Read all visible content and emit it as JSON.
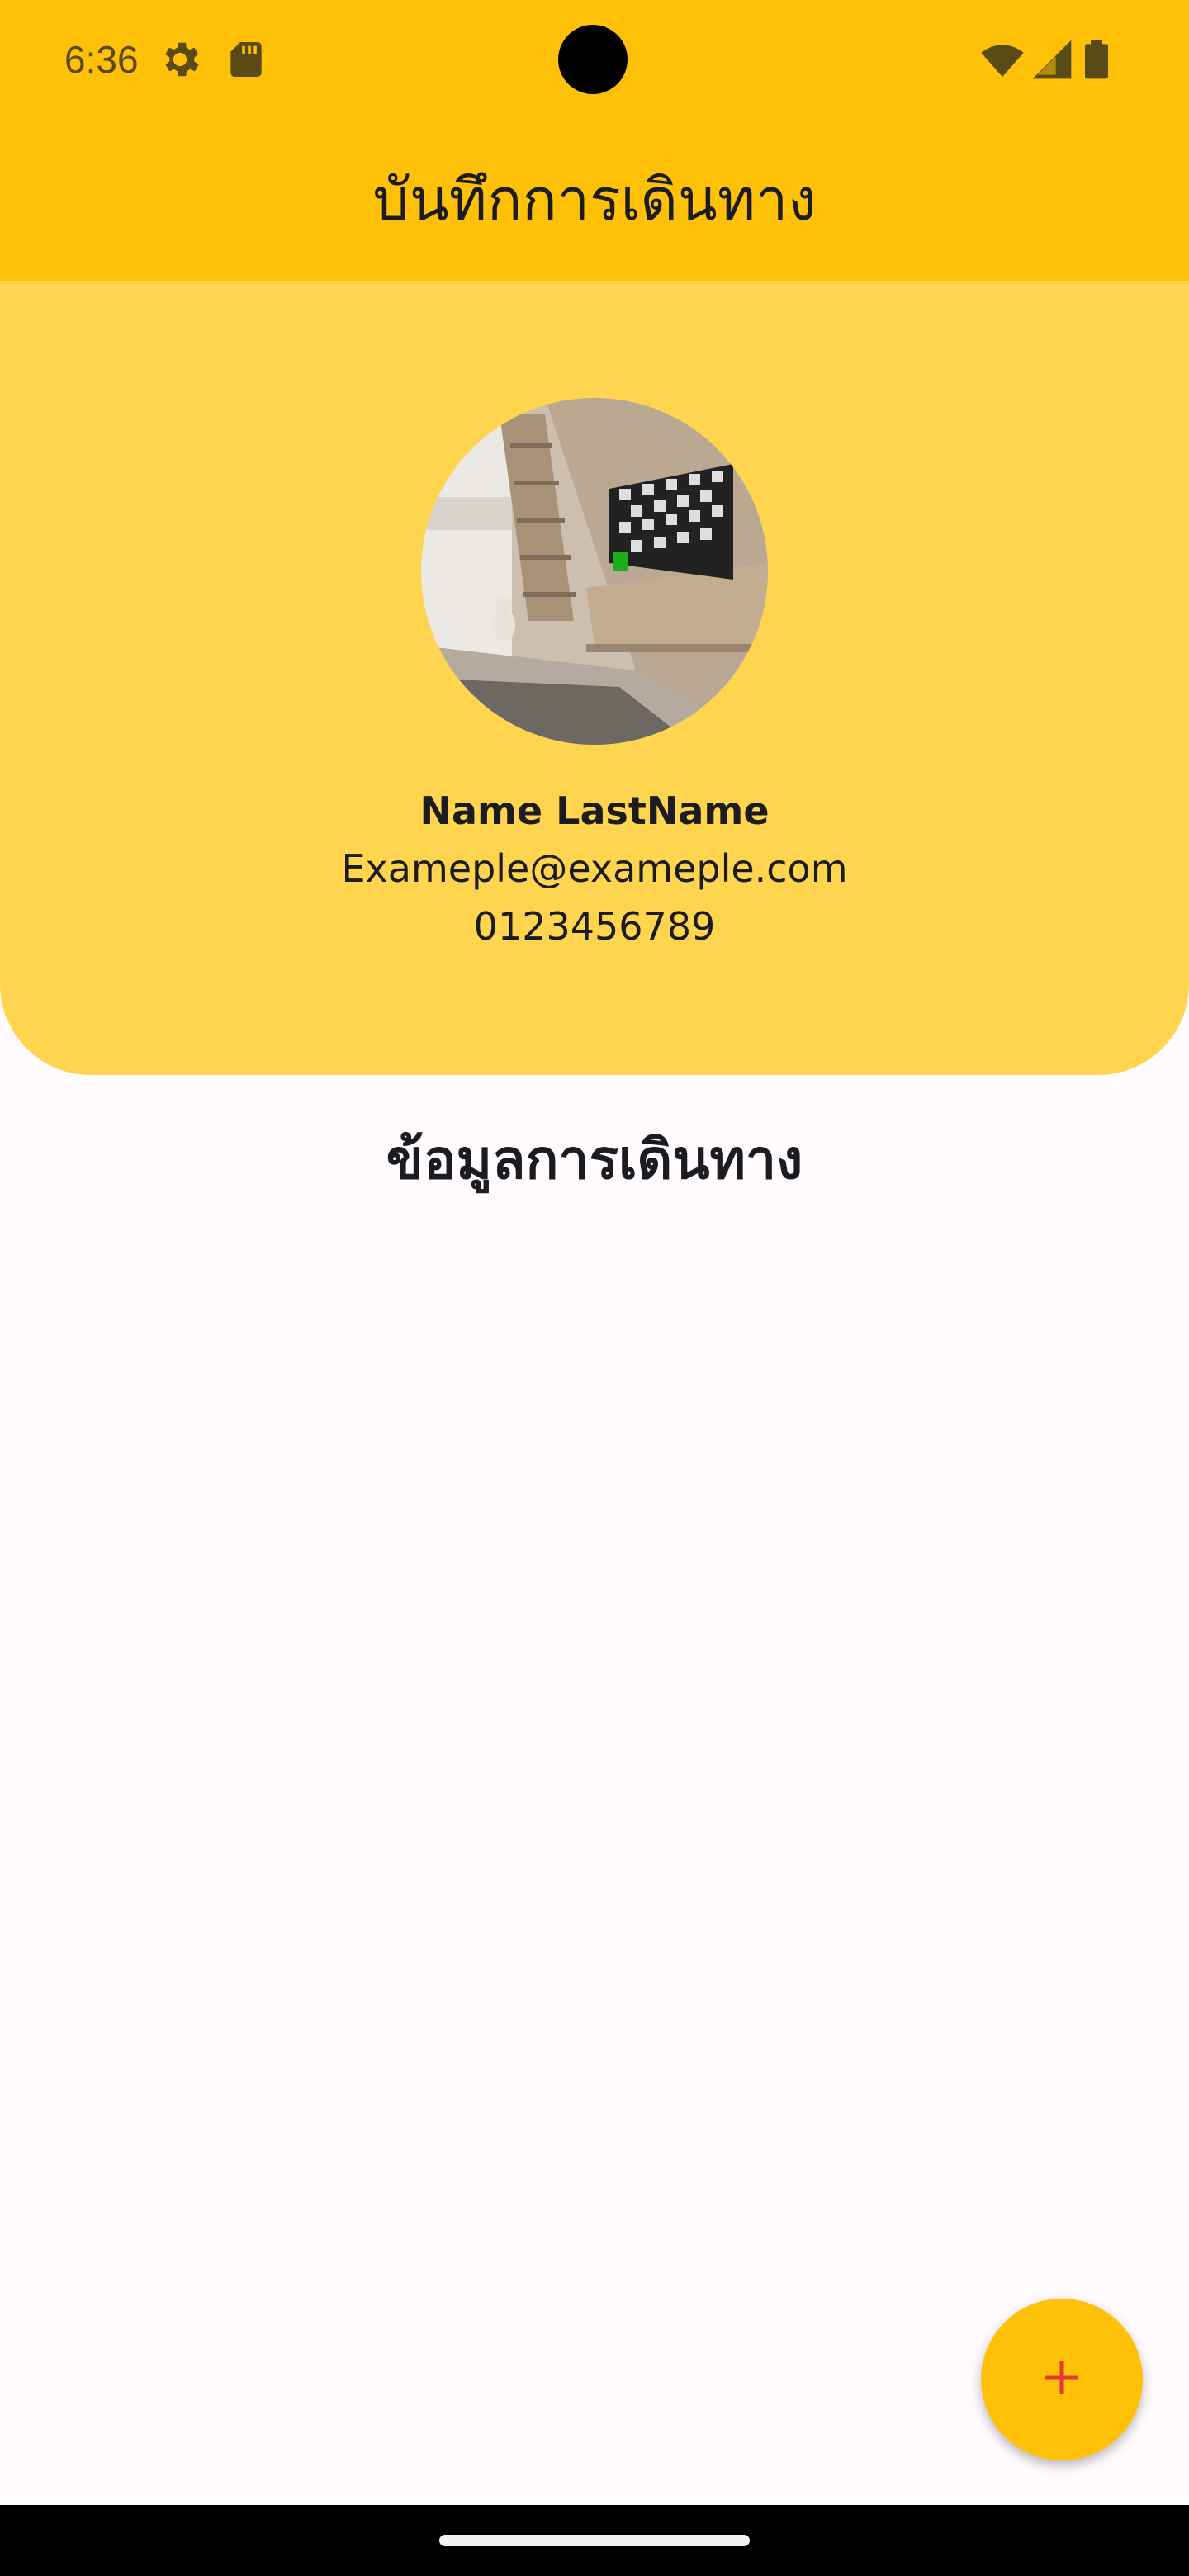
{
  "status_bar": {
    "time": "6:36",
    "icons_left": [
      "settings-icon",
      "sd-card-icon"
    ],
    "icons_right": [
      "wifi-icon",
      "cellular-signal-icon",
      "battery-icon"
    ]
  },
  "app_bar": {
    "title": "บันทึกการเดินทาง",
    "background_color": "#FFC107"
  },
  "profile": {
    "name": "Name LastName",
    "email": "Exameple@exameple.com",
    "phone": "0123456789",
    "card_color": "#FFD54F"
  },
  "section": {
    "title": "ข้อมูลการเดินทาง"
  },
  "fab": {
    "icon": "plus-icon",
    "background_color": "#FFC107",
    "icon_color": "#E53935"
  }
}
